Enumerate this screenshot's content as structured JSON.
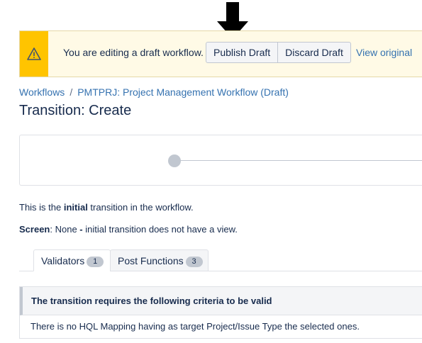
{
  "banner": {
    "icon": "warning-icon",
    "text": "You are editing a draft workflow.",
    "publish_label": "Publish Draft",
    "discard_label": "Discard Draft",
    "view_original_label": "View original",
    "accent_color": "#ffc400"
  },
  "breadcrumb": {
    "items": [
      "Workflows",
      "PMTPRJ: Project Management Workflow (Draft)"
    ],
    "separator": "/"
  },
  "page_title": "Transition: Create",
  "info": {
    "line1_pre": "This is the ",
    "line1_bold": "initial",
    "line1_post": " transition in the workflow.",
    "line2_label": "Screen",
    "line2_text": ": None ",
    "line2_bold": "-",
    "line2_post": " initial transition does not have a view."
  },
  "tabs": [
    {
      "label": "Validators",
      "count": "1",
      "active": true
    },
    {
      "label": "Post Functions",
      "count": "3",
      "active": false
    }
  ],
  "criteria": {
    "header": "The transition requires the following criteria to be valid",
    "body": "There is no HQL Mapping having as target Project/Issue Type the selected ones."
  }
}
